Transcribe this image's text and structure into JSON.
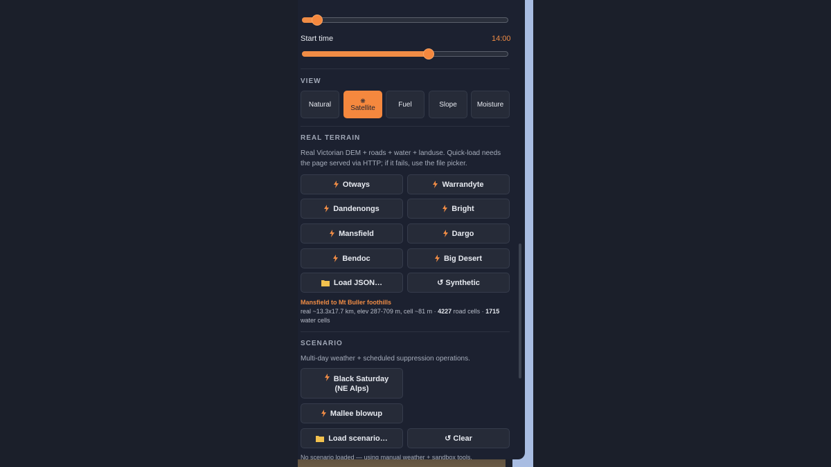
{
  "sliders": {
    "top": {
      "value_fraction": 0.07
    },
    "start_time": {
      "label": "Start time",
      "value": "14:00",
      "value_fraction": 0.61
    }
  },
  "view": {
    "heading": "VIEW",
    "options": [
      "Natural",
      "Satellite",
      "Fuel",
      "Slope",
      "Moisture"
    ],
    "active": "Satellite",
    "accent": "#f5883e"
  },
  "real_terrain": {
    "heading": "REAL TERRAIN",
    "description": "Real Victorian DEM + roads + water + landuse. Quick-load needs the page served via HTTP; if it fails, use the file picker.",
    "presets": [
      "Otways",
      "Warrandyte",
      "Dandenongs",
      "Bright",
      "Mansfield",
      "Dargo",
      "Bendoc",
      "Big Desert"
    ],
    "load_json": "Load JSON…",
    "synthetic": "↺ Synthetic",
    "loaded_title": "Mansfield to Mt Buller foothills",
    "loaded_info_prefix": "real ~13.3x17.7 km, elev 287-709 m, cell ~81 m · ",
    "road_cells": "4227",
    "road_label": " road cells · ",
    "water_cells": "1715",
    "water_label": " water cells"
  },
  "scenario": {
    "heading": "SCENARIO",
    "description": "Multi-day weather + scheduled suppression operations.",
    "black_saturday": "Black Saturday (NE Alps)",
    "mallee": "Mallee blowup",
    "load_scenario": "Load scenario…",
    "clear": "↺ Clear",
    "status": "No scenario loaded — using manual weather + sandbox tools."
  }
}
